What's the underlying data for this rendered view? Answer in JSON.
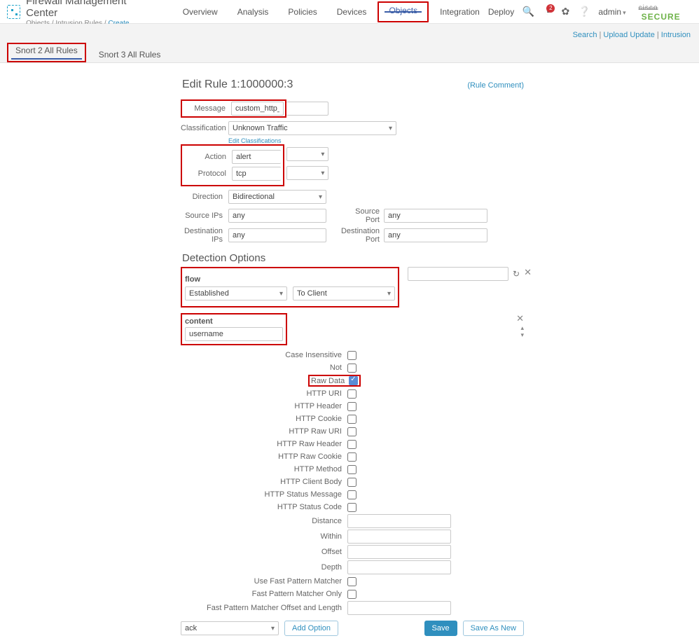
{
  "header": {
    "appTitle": "Firewall Management Center",
    "breadcrumb": {
      "a": "Objects",
      "b": "Intrusion Rules",
      "c": "Create"
    },
    "nav": {
      "overview": "Overview",
      "analysis": "Analysis",
      "policies": "Policies",
      "devices": "Devices",
      "objects": "Objects",
      "integration": "Integration"
    },
    "right": {
      "deploy": "Deploy",
      "admin": "admin",
      "badge": "2",
      "brand": "cisco",
      "secure": "SECURE"
    }
  },
  "subbar": {
    "links": {
      "search": "Search",
      "upload": "Upload Update",
      "intrusion": "Intrusion"
    },
    "tabs": {
      "snort2": "Snort 2 All Rules",
      "snort3": "Snort 3 All Rules"
    }
  },
  "form": {
    "title": "Edit Rule 1:1000000:3",
    "ruleComment": "(Rule Comment)",
    "labels": {
      "message": "Message",
      "classification": "Classification",
      "editClass": "Edit Classifications",
      "action": "Action",
      "protocol": "Protocol",
      "direction": "Direction",
      "srcIPs": "Source IPs",
      "srcPort": "Source Port",
      "dstIPs": "Destination IPs",
      "dstPort": "Destination Port"
    },
    "values": {
      "message": "custom_http_sig",
      "classification": "Unknown Traffic",
      "action": "alert",
      "protocol": "tcp",
      "direction": "Bidirectional",
      "srcIPs": "any",
      "srcPort": "any",
      "dstIPs": "any",
      "dstPort": "any"
    }
  },
  "detection": {
    "title": "Detection Options",
    "flow": {
      "label": "flow",
      "established": "Established",
      "toClient": "To Client"
    },
    "content": {
      "label": "content",
      "value": "username"
    },
    "options": {
      "caseInsensitive": "Case Insensitive",
      "not": "Not",
      "rawData": "Raw Data",
      "httpURI": "HTTP URI",
      "httpHeader": "HTTP Header",
      "httpCookie": "HTTP Cookie",
      "httpRawURI": "HTTP Raw URI",
      "httpRawHeader": "HTTP Raw Header",
      "httpRawCookie": "HTTP Raw Cookie",
      "httpMethod": "HTTP Method",
      "httpClientBody": "HTTP Client Body",
      "httpStatusMessage": "HTTP Status Message",
      "httpStatusCode": "HTTP Status Code",
      "distance": "Distance",
      "within": "Within",
      "offset": "Offset",
      "depth": "Depth",
      "useFPM": "Use Fast Pattern Matcher",
      "fpmOnly": "Fast Pattern Matcher Only",
      "fpmOffsetLen": "Fast Pattern Matcher Offset and Length"
    }
  },
  "footer": {
    "ack": "ack",
    "addOption": "Add Option",
    "save": "Save",
    "saveAsNew": "Save As New"
  }
}
